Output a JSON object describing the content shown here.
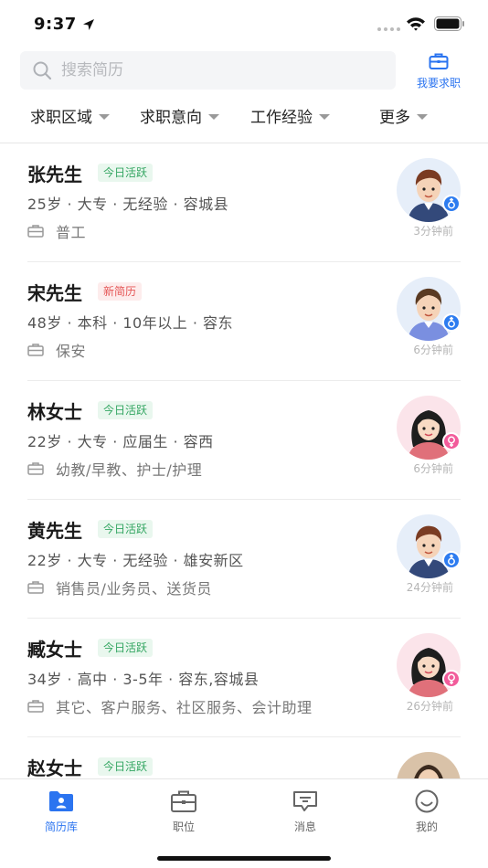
{
  "status": {
    "time": "9:37"
  },
  "search": {
    "placeholder": "搜索简历",
    "job_seek_label": "我要求职"
  },
  "filters": [
    {
      "label": "求职区域"
    },
    {
      "label": "求职意向"
    },
    {
      "label": "工作经验"
    },
    {
      "label": "更多"
    }
  ],
  "resumes": [
    {
      "name": "张先生",
      "badge": "今日活跃",
      "badge_type": "active",
      "info": "25岁 · 大专 · 无经验 · 容城县",
      "job": "普工",
      "time": "3分钟前",
      "gender": "male"
    },
    {
      "name": "宋先生",
      "badge": "新简历",
      "badge_type": "new",
      "info": "48岁 · 本科 · 10年以上 · 容东",
      "job": "保安",
      "time": "6分钟前",
      "gender": "male"
    },
    {
      "name": "林女士",
      "badge": "今日活跃",
      "badge_type": "active",
      "info": "22岁 · 大专 · 应届生 · 容西",
      "job": "幼教/早教、护士/护理",
      "time": "6分钟前",
      "gender": "female"
    },
    {
      "name": "黄先生",
      "badge": "今日活跃",
      "badge_type": "active",
      "info": "22岁 · 大专 · 无经验 · 雄安新区",
      "job": "销售员/业务员、送货员",
      "time": "24分钟前",
      "gender": "male"
    },
    {
      "name": "臧女士",
      "badge": "今日活跃",
      "badge_type": "active",
      "info": "34岁 · 高中 · 3-5年 · 容东,容城县",
      "job": "其它、客户服务、社区服务、会计助理",
      "time": "26分钟前",
      "gender": "female"
    },
    {
      "name": "赵女士",
      "badge": "今日活跃",
      "badge_type": "active",
      "info": "",
      "job": "",
      "time": "",
      "gender": "female"
    }
  ],
  "tabs": [
    {
      "label": "简历库",
      "icon": "folder-user-icon",
      "active": true
    },
    {
      "label": "职位",
      "icon": "briefcase-icon",
      "active": false
    },
    {
      "label": "消息",
      "icon": "message-icon",
      "active": false
    },
    {
      "label": "我的",
      "icon": "smile-icon",
      "active": false
    }
  ],
  "colors": {
    "accent": "#2b74f0",
    "active_badge": "#34a662",
    "new_badge": "#e55656",
    "male": "#2d7cf0",
    "female": "#f25c9b"
  }
}
